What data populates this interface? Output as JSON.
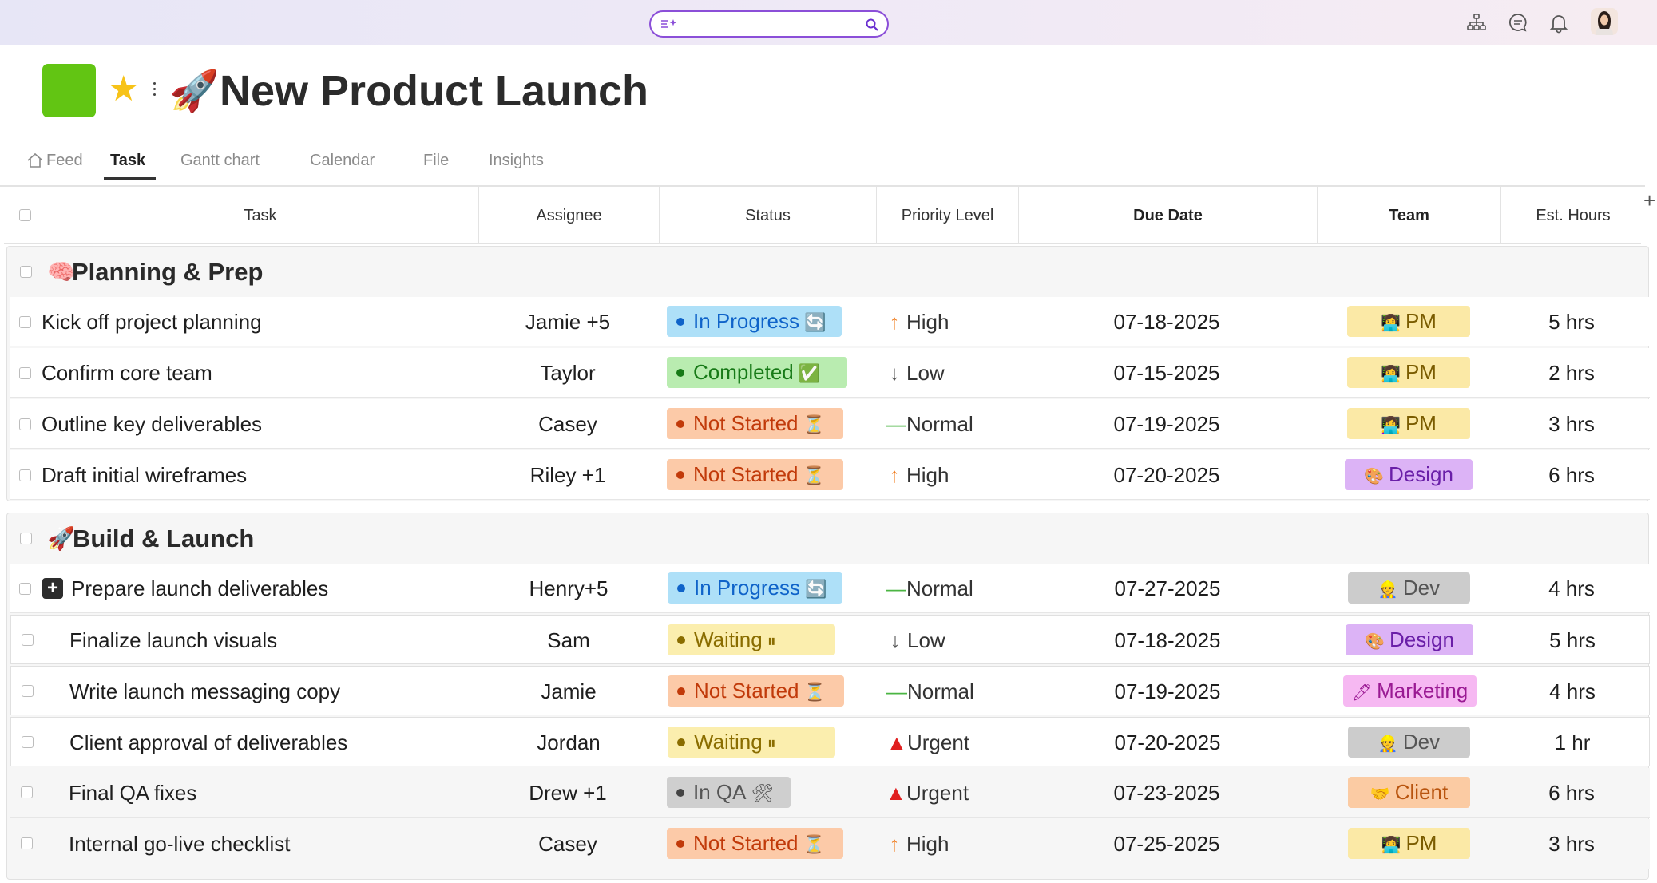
{
  "topbar": {
    "search_placeholder": "",
    "icons": [
      "sparkle-icon",
      "search-icon",
      "org-chart-icon",
      "chat-icon",
      "bell-icon",
      "avatar"
    ]
  },
  "project": {
    "color": "#62c513",
    "star": "★",
    "emoji": "🚀",
    "title": "New Product Launch"
  },
  "tabs": [
    {
      "label": "Feed",
      "active": false
    },
    {
      "label": "Task",
      "active": true
    },
    {
      "label": "Gantt chart",
      "active": false
    },
    {
      "label": "Calendar",
      "active": false
    },
    {
      "label": "File",
      "active": false
    },
    {
      "label": "Insights",
      "active": false
    }
  ],
  "columns": [
    "Task",
    "Assignee",
    "Status",
    "Priority Level",
    "Due Date",
    "Team",
    "Est. Hours"
  ],
  "add_column": "+",
  "groups": [
    {
      "emoji": "🧠",
      "name": "Planning & Prep",
      "rows": [
        {
          "task": "Kick off project planning",
          "assignee": "Jamie +5",
          "status": "In Progress",
          "status_emoji": "🔄",
          "priority": "High",
          "due": "07-18-2025",
          "team": "PM",
          "team_emoji": "👩‍💻",
          "hours": "5 hrs"
        },
        {
          "task": "Confirm core team",
          "assignee": "Taylor",
          "status": "Completed",
          "status_emoji": "✅",
          "priority": "Low",
          "due": "07-15-2025",
          "team": "PM",
          "team_emoji": "👩‍💻",
          "hours": "2 hrs"
        },
        {
          "task": "Outline key deliverables",
          "assignee": "Casey",
          "status": "Not Started",
          "status_emoji": "⏳",
          "priority": "Normal",
          "due": "07-19-2025",
          "team": "PM",
          "team_emoji": "👩‍💻",
          "hours": "3 hrs"
        },
        {
          "task": "Draft initial wireframes",
          "assignee": "Riley +1",
          "status": "Not Started",
          "status_emoji": "⏳",
          "priority": "High",
          "due": "07-20-2025",
          "team": "Design",
          "team_emoji": "🎨",
          "hours": "6 hrs"
        }
      ]
    },
    {
      "emoji": "🚀",
      "name": "Build & Launch",
      "rows": [
        {
          "task": "Prepare launch deliverables",
          "assignee": "Henry+5",
          "status": "In Progress",
          "status_emoji": "🔄",
          "priority": "Normal",
          "due": "07-27-2025",
          "team": "Dev",
          "team_emoji": "👷",
          "hours": "4 hrs",
          "expand": "+"
        },
        {
          "task": "Finalize launch visuals",
          "assignee": "Sam",
          "status": "Waiting",
          "status_emoji": "⏸",
          "priority": "Low",
          "due": "07-18-2025",
          "team": "Design",
          "team_emoji": "🎨",
          "hours": "5 hrs"
        },
        {
          "task": "Write launch messaging copy",
          "assignee": "Jamie",
          "status": "Not Started",
          "status_emoji": "⏳",
          "priority": "Normal",
          "due": "07-19-2025",
          "team": "Marketing",
          "team_emoji": "🖊",
          "hours": "4 hrs"
        },
        {
          "task": "Client approval of deliverables",
          "assignee": "Jordan",
          "status": "Waiting",
          "status_emoji": "⏸",
          "priority": "Urgent",
          "due": "07-20-2025",
          "team": "Dev",
          "team_emoji": "👷",
          "hours": "1 hr"
        },
        {
          "task": "Final QA fixes",
          "assignee": "Drew +1",
          "status": "In QA",
          "status_emoji": "🛠",
          "priority": "Urgent",
          "due": "07-23-2025",
          "team": "Client",
          "team_emoji": "🤝",
          "hours": "6 hrs"
        },
        {
          "task": "Internal go-live checklist",
          "assignee": "Casey",
          "status": "Not Started",
          "status_emoji": "⏳",
          "priority": "High",
          "due": "07-25-2025",
          "team": "PM",
          "team_emoji": "👩‍💻",
          "hours": "3 hrs"
        }
      ]
    }
  ]
}
